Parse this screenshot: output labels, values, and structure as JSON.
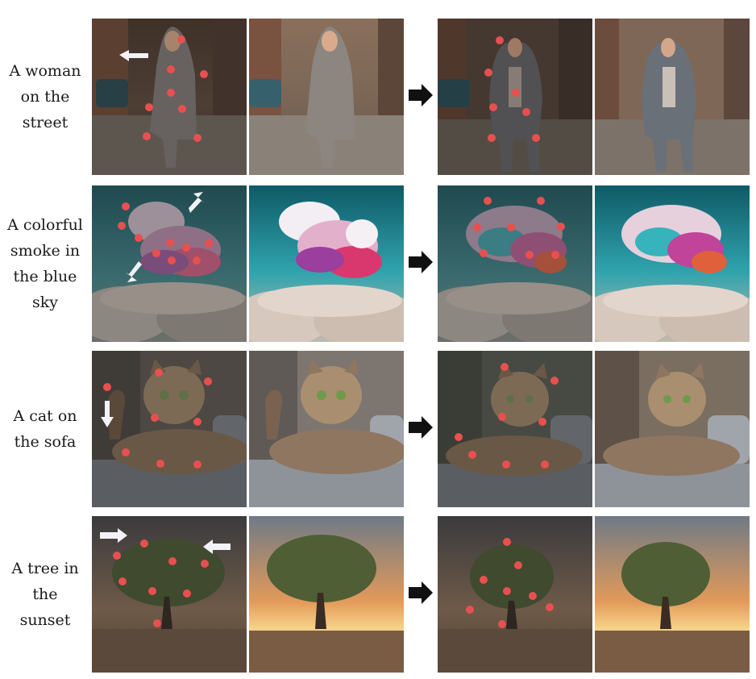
{
  "rows": [
    {
      "id": "woman",
      "caption_lines": [
        "A woman",
        "on the",
        "street"
      ]
    },
    {
      "id": "smoke",
      "caption_lines": [
        "A colorful",
        "smoke in",
        "the blue",
        "sky"
      ]
    },
    {
      "id": "cat",
      "caption_lines": [
        "A cat on",
        "the sofa"
      ]
    },
    {
      "id": "tree",
      "caption_lines": [
        "A tree in",
        "the",
        "sunset"
      ]
    }
  ],
  "colors": {
    "point": "#e8504f",
    "drag_arrow": "#f3f3f7",
    "flow_arrow": "#111111"
  },
  "icons": {
    "drag": "white-direction-arrow-icon",
    "flow": "black-right-arrow-icon"
  }
}
